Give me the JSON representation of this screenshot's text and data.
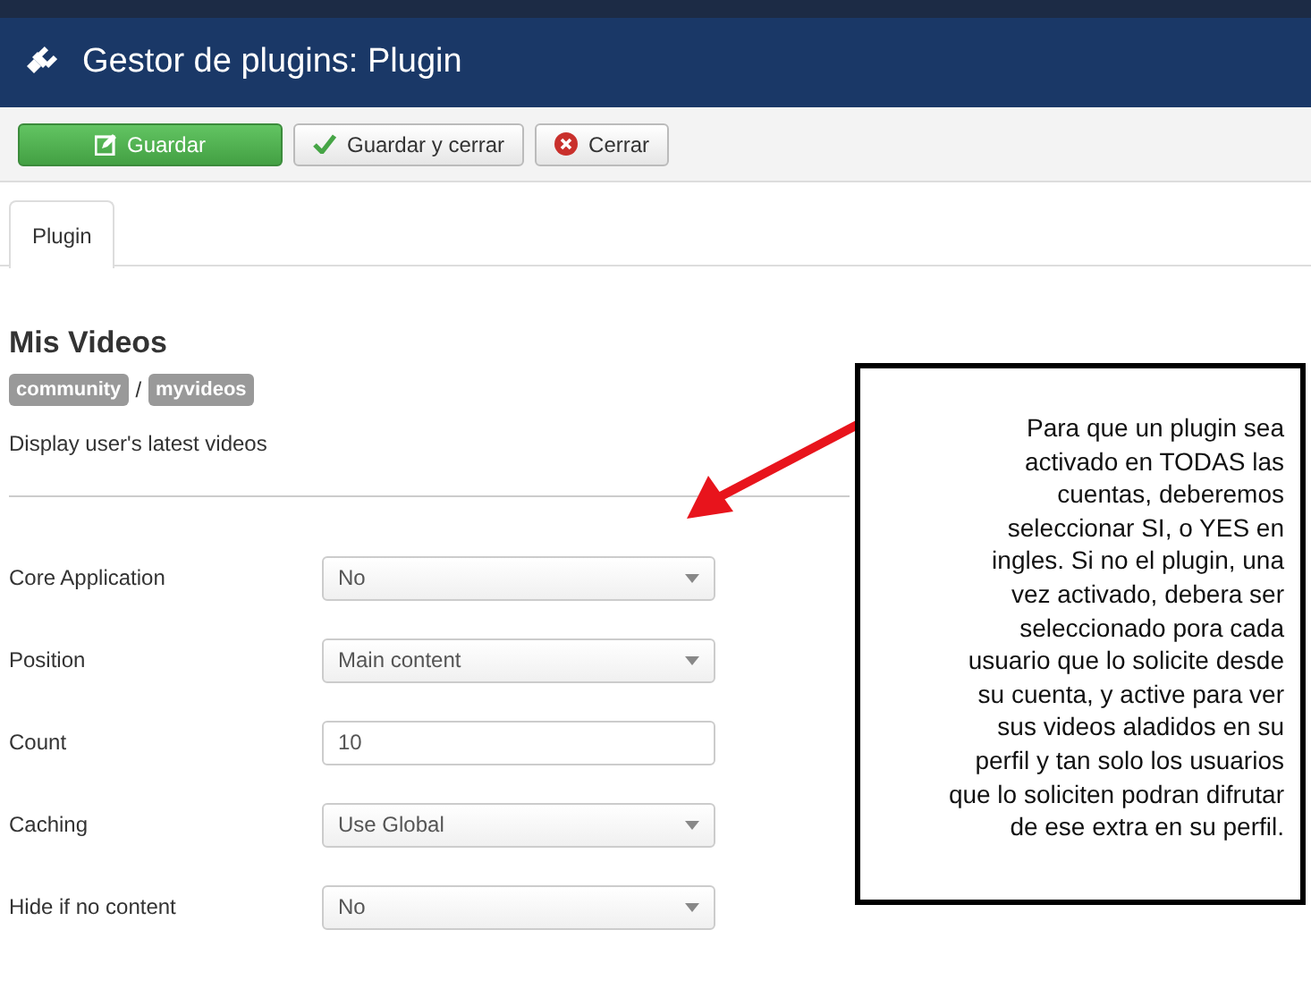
{
  "header": {
    "title": "Gestor de plugins: Plugin"
  },
  "toolbar": [
    {
      "label": "Guardar",
      "kind": "primary"
    },
    {
      "label": "Guardar y cerrar",
      "kind": "check"
    },
    {
      "label": "Cerrar",
      "kind": "close"
    }
  ],
  "tabs": [
    {
      "label": "Plugin",
      "selected": true
    }
  ],
  "plugin": {
    "title": "Mis Videos",
    "tags": [
      "community",
      "myvideos"
    ],
    "separator": "/",
    "description": "Display user's latest videos"
  },
  "fields": [
    {
      "label": "Core Application",
      "kind": "select",
      "value": "No"
    },
    {
      "label": "Position",
      "kind": "select",
      "value": "Main content"
    },
    {
      "label": "Count",
      "kind": "input",
      "value": "10"
    },
    {
      "label": "Caching",
      "kind": "select",
      "value": "Use Global"
    },
    {
      "label": "Hide if no content",
      "kind": "select",
      "value": "No"
    }
  ],
  "annotation": {
    "text": "Para que un plugin sea\nactivado en TODAS las\ncuentas, deberemos\nseleccionar SI, o YES en\ningles. Si no el plugin, una\nvez activado, debera ser\nseleccionado pora cada\nusuario que lo solicite desde\nsu cuenta, y active para ver\nsus videos aladidos en su\nperfil y tan solo los usuarios\nque lo soliciten podran difrutar\nde ese extra en su perfil."
  }
}
